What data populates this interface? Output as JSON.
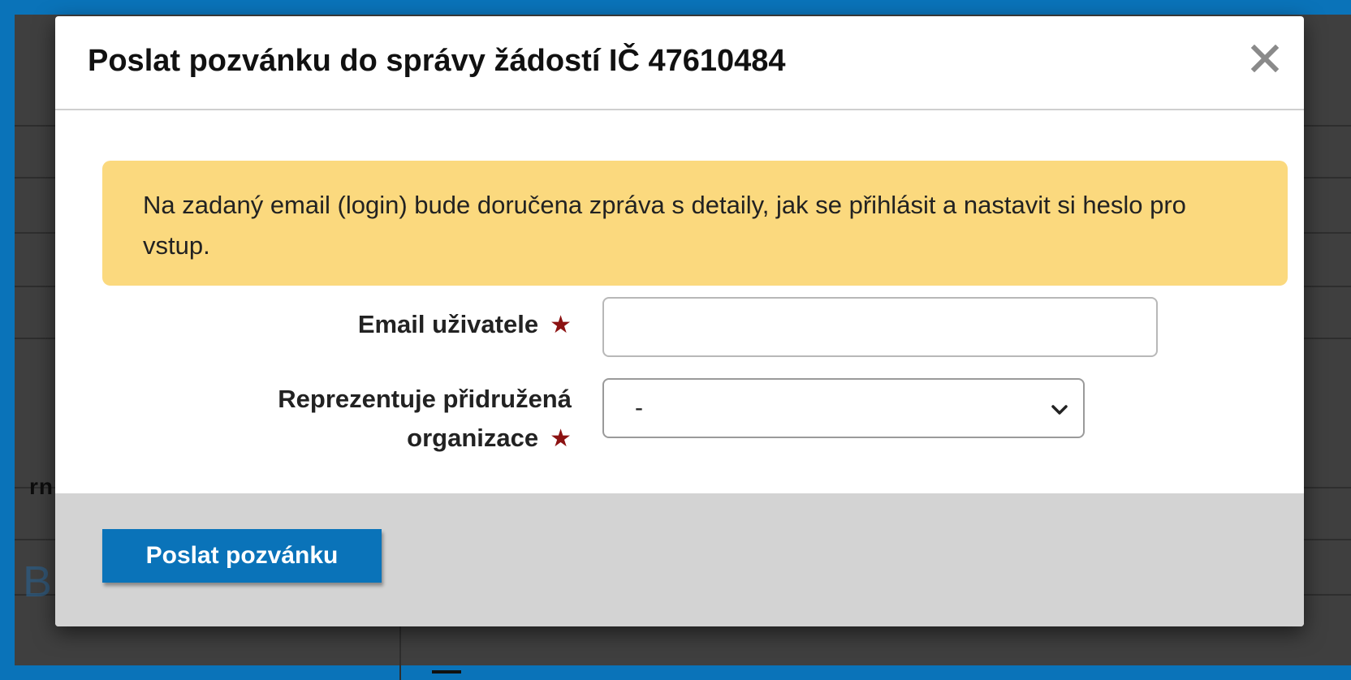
{
  "background": {
    "partial_label": "rní"
  },
  "modal": {
    "title": "Poslat pozvánku do správy žádostí IČ 47610484",
    "close_icon": "close-icon",
    "info_message": "Na zadaný email (login) bude doručena zpráva s detaily, jak se přihlásit a nastavit si heslo pro vstup.",
    "form": {
      "email_label": "Email uživatele",
      "email_value": "",
      "email_placeholder": "",
      "org_label": "Reprezentuje přidružená organizace",
      "org_selected": "-",
      "required_marker": "★"
    },
    "submit_label": "Poslat pozvánku"
  },
  "colors": {
    "accent": "#0a73b9",
    "alert_bg": "#fbd97e",
    "required": "#8c1212",
    "footer_bg": "#d3d3d3"
  }
}
